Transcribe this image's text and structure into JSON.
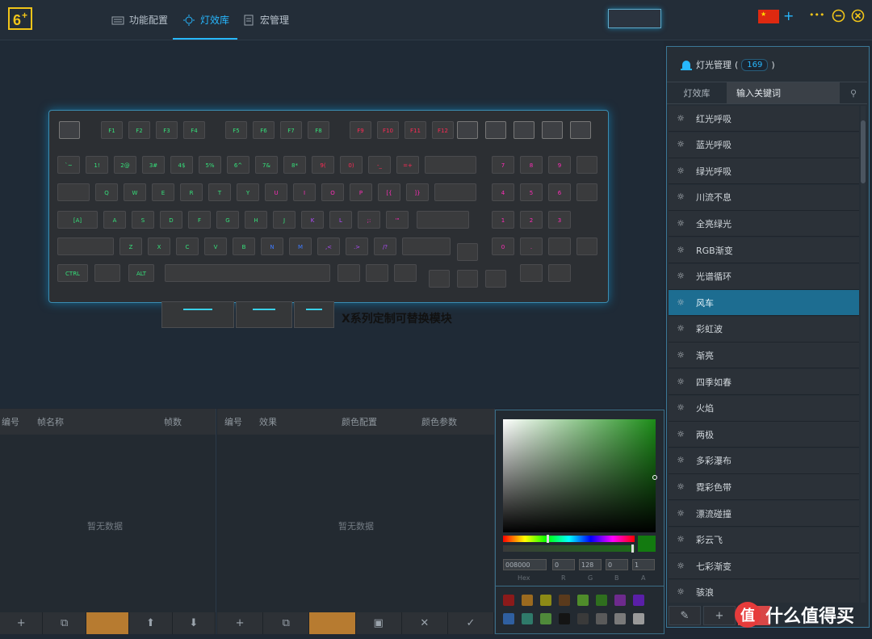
{
  "nav": [
    {
      "label": "功能配置",
      "icon": "keyboard-icon"
    },
    {
      "label": "灯效库",
      "icon": "sun-icon",
      "active": true
    },
    {
      "label": "宏管理",
      "icon": "document-icon"
    }
  ],
  "topbar": {
    "add": "+",
    "more": "•••",
    "minimize": "−"
  },
  "keyboard": {
    "fn_row": [
      "F1",
      "F2",
      "F3",
      "F4",
      "F5",
      "F6",
      "F7",
      "F8",
      "F9",
      "F10",
      "F11",
      "F12"
    ],
    "num_row": [
      "`~",
      "1!",
      "2@",
      "3#",
      "4$",
      "5%",
      "6^",
      "7&",
      "8*",
      "9(",
      "0)",
      "-_",
      "=+"
    ],
    "row_q": [
      "Q",
      "W",
      "E",
      "R",
      "T",
      "Y",
      "U",
      "I",
      "O",
      "P",
      "[{",
      "]}"
    ],
    "row_a": [
      "A",
      "S",
      "D",
      "F",
      "G",
      "H",
      "J",
      "K",
      "L",
      ";:",
      "'\""
    ],
    "row_z": [
      "Z",
      "X",
      "C",
      "V",
      "B",
      "N",
      "M",
      ",<",
      ".>",
      "/?"
    ],
    "ctrl": "CTRL",
    "alt": "ALT",
    "caps": "[A]",
    "numpad": [
      "7",
      "8",
      "9",
      "4",
      "5",
      "6",
      "1",
      "2",
      "3",
      "0",
      "."
    ]
  },
  "module_label": "X系列定制可替换模块",
  "frames_panel": {
    "col_index": "编号",
    "col_name": "帧名称",
    "col_count": "帧数",
    "empty": "暂无数据"
  },
  "effects_panel": {
    "col_index": "编号",
    "col_effect": "效果",
    "col_color": "颜色配置",
    "col_param": "颜色参数",
    "empty": "暂无数据"
  },
  "picker": {
    "hex": "008000",
    "r": "0",
    "g": "128",
    "b": "0",
    "a": "1",
    "labels": [
      "Hex",
      "R",
      "G",
      "B",
      "A"
    ],
    "swatches": [
      "#8b1a1a",
      "#9b6a1f",
      "#8c8a16",
      "#5a3a1c",
      "#4f8c2a",
      "#2f6f1e",
      "#6d2a8d",
      "#5a1fa8",
      "#2f5fa0",
      "#2f7a6a",
      "#4f8a3a",
      "#141414",
      "#3a3a3a",
      "#5a5a5a",
      "#7a7a7a",
      "#9a9a9a"
    ]
  },
  "right": {
    "title": "灯光管理",
    "count": "169",
    "tab": "灯效库",
    "search_placeholder": "输入关键词",
    "items": [
      "红光呼吸",
      "蓝光呼吸",
      "绿光呼吸",
      "川流不息",
      "全亮绿光",
      "RGB渐变",
      "光谱循环",
      "风车",
      "彩虹波",
      "渐亮",
      "四季如春",
      "火焰",
      "两极",
      "多彩瀑布",
      "霓彩色带",
      "漂流碰撞",
      "彩云飞",
      "七彩渐变",
      "骇浪"
    ],
    "selected": "风车"
  },
  "watermark": {
    "logo": "值",
    "text": "什么值得买"
  }
}
